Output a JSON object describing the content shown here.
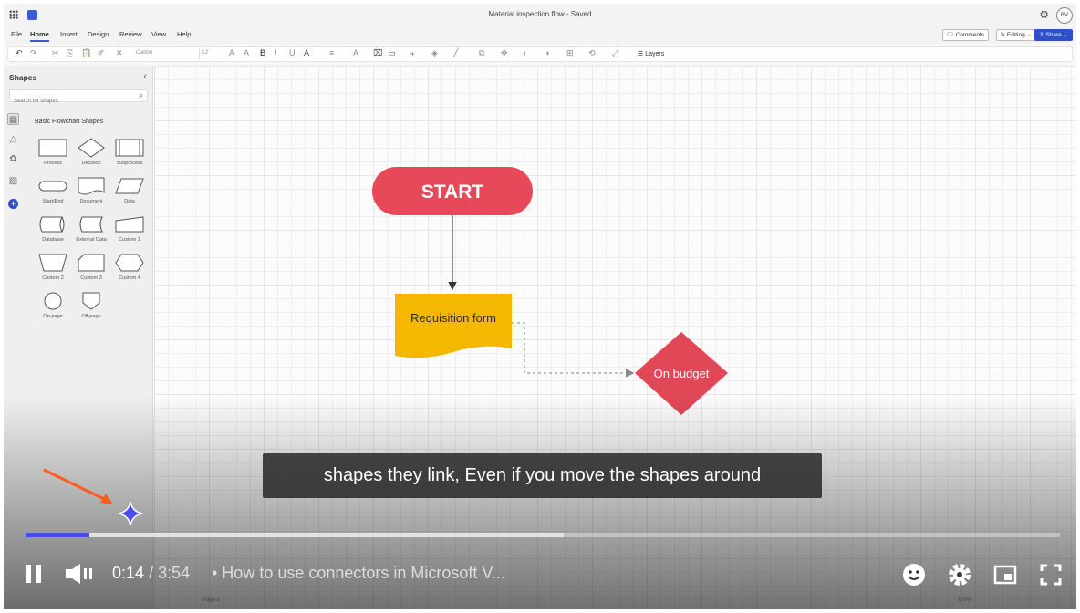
{
  "window": {
    "title": "Material inspection flow - Saved",
    "user_initials": "BV"
  },
  "menu": {
    "items": [
      "File",
      "Home",
      "Insert",
      "Design",
      "Review",
      "View",
      "Help"
    ],
    "active": "Home",
    "comments": "Comments",
    "editing": "Editing",
    "share": "Share"
  },
  "toolbar": {
    "font": "Calibri",
    "font_size": "12",
    "layers": "Layers"
  },
  "shapes_panel": {
    "title": "Shapes",
    "search_placeholder": "Search for shapes",
    "category": "Basic Flowchart Shapes",
    "shapes": [
      "Process",
      "Decision",
      "Subprocess",
      "Start/End",
      "Document",
      "Data",
      "Database",
      "External Data",
      "Custom 1",
      "Custom 2",
      "Custom 3",
      "Custom 4",
      "On-page",
      "Off-page"
    ]
  },
  "diagram": {
    "start_label": "START",
    "document_label": "Requisition form",
    "decision_label": "On budget",
    "colors": {
      "start": "#e8495a",
      "document": "#f5b800",
      "decision": "#e04857"
    }
  },
  "video": {
    "caption": "shapes they link, Even if you move the shapes around",
    "current_time": "0:14",
    "duration": "/ 3:54",
    "title": "• How to use connectors in Microsoft V...",
    "progress_played": 0.062,
    "progress_buffered": 0.52,
    "accent": "#4a4ee6"
  },
  "statusbar": {
    "page": "Page-1",
    "zoom": "100%"
  }
}
